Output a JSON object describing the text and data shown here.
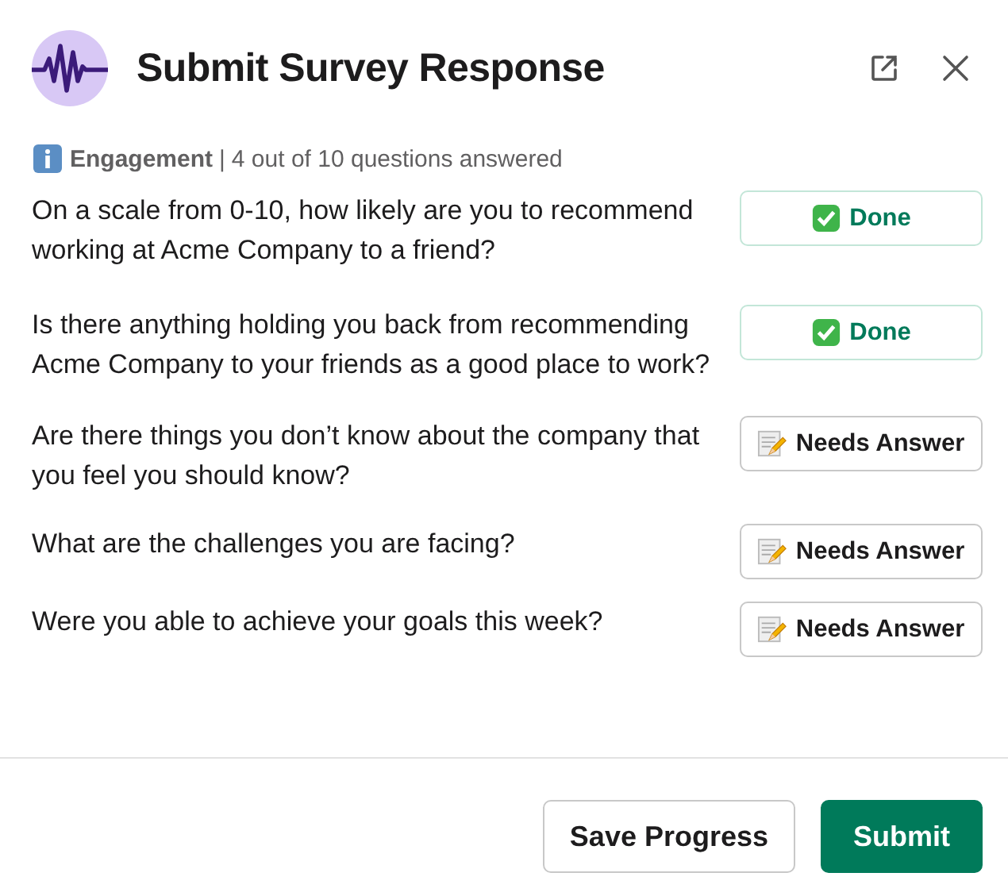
{
  "window": {
    "title": "Submit Survey Response"
  },
  "summary": {
    "category": "Engagement",
    "separator": "|",
    "progress": "4 out of 10 questions answered"
  },
  "questions": [
    {
      "text": "On a scale from 0-10, how likely are you to recommend working at Acme Company to a friend?",
      "kind": "done",
      "status": "Done"
    },
    {
      "text": "Is there anything holding you back from recommending Acme Company to your friends as a good place to work?",
      "kind": "done",
      "status": "Done"
    },
    {
      "text": "Are there things you don’t know about the company that you feel you should know?",
      "kind": "pending",
      "status": "Needs Answer"
    },
    {
      "text": "What are the challenges you are facing?",
      "kind": "pending",
      "status": "Needs Answer"
    },
    {
      "text": "Were you able to achieve your goals this week?",
      "kind": "pending",
      "status": "Needs Answer"
    }
  ],
  "buttons": [
    {
      "label": "Save Progress",
      "kind": "secondary"
    },
    {
      "label": "Submit",
      "kind": "primary"
    }
  ]
}
